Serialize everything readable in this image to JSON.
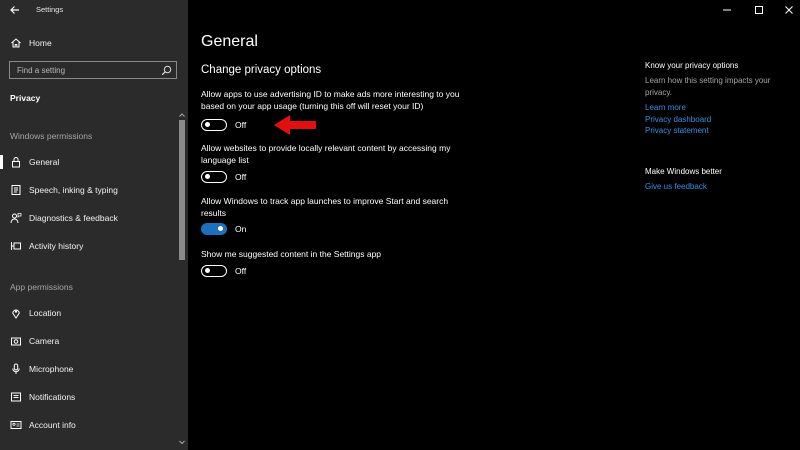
{
  "window": {
    "title": "Settings"
  },
  "sidebar": {
    "home_label": "Home",
    "search_placeholder": "Find a setting",
    "section_label": "Privacy",
    "groups": [
      {
        "header": "Windows permissions",
        "items": [
          {
            "label": "General",
            "icon": "lock-icon",
            "active": true
          },
          {
            "label": "Speech, inking & typing",
            "icon": "speech-document-icon"
          },
          {
            "label": "Diagnostics & feedback",
            "icon": "person-feedback-icon"
          },
          {
            "label": "Activity history",
            "icon": "activity-timeline-icon"
          }
        ]
      },
      {
        "header": "App permissions",
        "items": [
          {
            "label": "Location",
            "icon": "location-pin-icon"
          },
          {
            "label": "Camera",
            "icon": "camera-icon"
          },
          {
            "label": "Microphone",
            "icon": "microphone-icon"
          },
          {
            "label": "Notifications",
            "icon": "notifications-icon"
          },
          {
            "label": "Account info",
            "icon": "account-card-icon"
          }
        ]
      }
    ]
  },
  "main": {
    "title": "General",
    "subtitle": "Change privacy options",
    "settings": [
      {
        "description": "Allow apps to use advertising ID to make ads more interesting to you based on your app usage (turning this off will reset your ID)",
        "state": "Off"
      },
      {
        "description": "Allow websites to provide locally relevant content by accessing my language list",
        "state": "Off"
      },
      {
        "description": "Allow Windows to track app launches to improve Start and search results",
        "state": "On"
      },
      {
        "description": "Show me suggested content in the Settings app",
        "state": "Off"
      }
    ]
  },
  "aside": {
    "privacy_heading": "Know your privacy options",
    "privacy_text": "Learn how this setting impacts your privacy.",
    "links": [
      "Learn more",
      "Privacy dashboard",
      "Privacy statement"
    ],
    "better_heading": "Make Windows better",
    "feedback_link": "Give us feedback"
  },
  "colors": {
    "accent": "#1e6fbf",
    "link": "#3a8de0",
    "sidebar_bg": "#2b2b2b",
    "arrow": "#e01010"
  }
}
